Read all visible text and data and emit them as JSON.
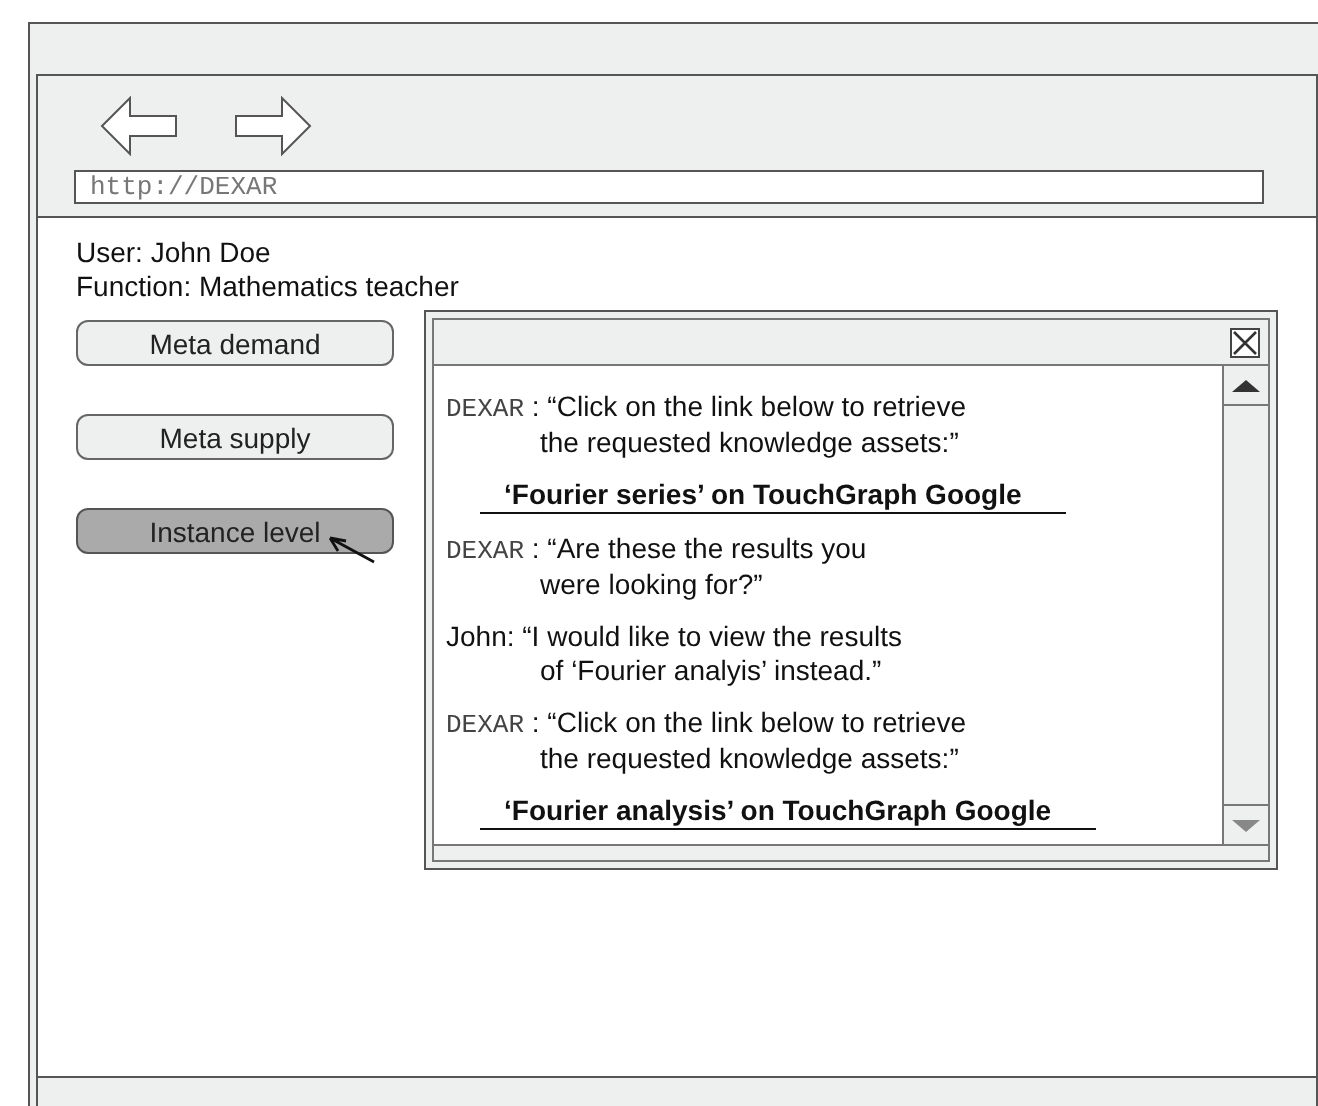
{
  "browser": {
    "address": "http://DEXAR"
  },
  "user": {
    "name_line": "User: John Doe",
    "function_line": "Function: Mathematics teacher"
  },
  "menu": [
    {
      "label": "Meta demand",
      "selected": false
    },
    {
      "label": "Meta supply",
      "selected": false
    },
    {
      "label": "Instance level",
      "selected": true
    }
  ],
  "dialog": {
    "messages": [
      {
        "kind": "system",
        "speaker": "DEXAR",
        "lines": [
          " : “Click on the link below to retrieve",
          "the requested knowledge assets:”"
        ]
      },
      {
        "kind": "link",
        "text": "‘Fourier series’ on TouchGraph Google"
      },
      {
        "kind": "system",
        "speaker": "DEXAR",
        "lines": [
          " : “Are these the results you",
          "were looking for?”"
        ]
      },
      {
        "kind": "user",
        "speaker": "John:",
        "lines": [
          " “I would like to view the results",
          "of ‘Fourier analyis’ instead.”"
        ]
      },
      {
        "kind": "system",
        "speaker": "DEXAR",
        "lines": [
          " : “Click on the link below to retrieve",
          "the requested knowledge assets:”"
        ]
      },
      {
        "kind": "link",
        "text": "‘Fourier analysis’ on TouchGraph Google"
      }
    ]
  }
}
